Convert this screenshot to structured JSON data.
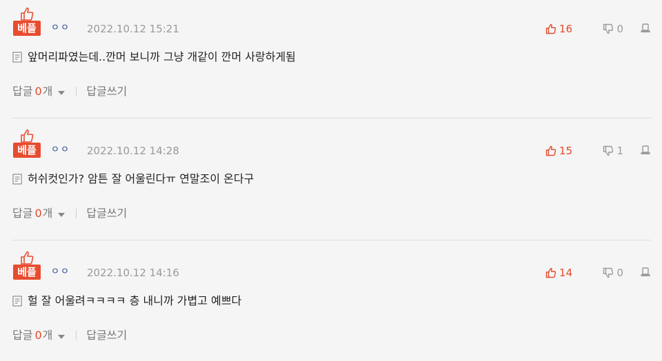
{
  "colors": {
    "accent": "#e84c2f",
    "like": "#e14a2b",
    "nick": "#1f3f8f",
    "muted": "#9a9a9a",
    "background": "#f5f5f5"
  },
  "comments": [
    {
      "badge": "베플",
      "nick": "ㅇㅇ",
      "date": "2022.10.12 15:21",
      "likes": "16",
      "dislikes": "0",
      "text": "앞머리파였는데..깐머 보니까 그냥 개같이 깐머 사랑하게됨",
      "reply_label": "답글",
      "reply_count": "0",
      "reply_unit": "개",
      "write_reply": "답글쓰기"
    },
    {
      "badge": "베플",
      "nick": "ㅇㅇ",
      "date": "2022.10.12 14:28",
      "likes": "15",
      "dislikes": "1",
      "text": "허쉬컷인가? 암튼 잘 어울린다ㅠ 연말조이 온다구",
      "reply_label": "답글",
      "reply_count": "0",
      "reply_unit": "개",
      "write_reply": "답글쓰기"
    },
    {
      "badge": "베플",
      "nick": "ㅇㅇ",
      "date": "2022.10.12 14:16",
      "likes": "14",
      "dislikes": "0",
      "text": "헐 잘 어울려ㅋㅋㅋㅋ 층 내니까 가볍고 예쁘다",
      "reply_label": "답글",
      "reply_count": "0",
      "reply_unit": "개",
      "write_reply": "답글쓰기"
    }
  ]
}
